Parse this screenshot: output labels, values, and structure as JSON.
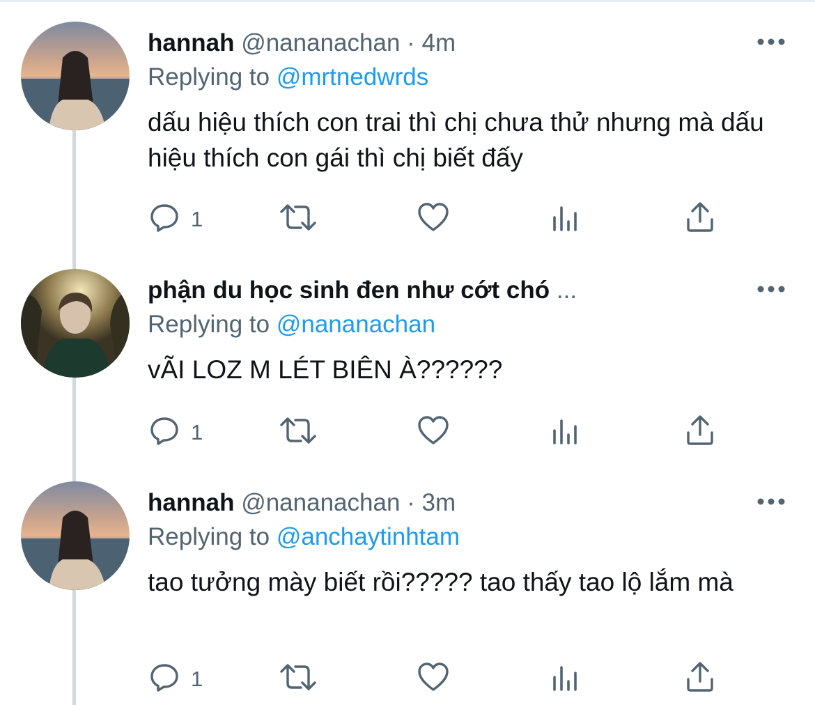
{
  "colors": {
    "link": "#1d9bf0",
    "secondary_text": "#536471",
    "primary_text": "#0f1419",
    "icon": "#536471",
    "thread_line": "#cfd9de"
  },
  "tweets": [
    {
      "name": "hannah",
      "handle": "@nananachan",
      "separator": "·",
      "time": "4m",
      "replying_label": "Replying to",
      "replying_to": "@mrtnedwrds",
      "text": "dấu hiệu thích con trai thì chị chưa thử nhưng mà dấu hiệu thích con gái thì chị biết đấy",
      "reply_count": "1",
      "avatar_icon": "avatar-sunset-girl"
    },
    {
      "name": "phận du học sinh đen như cớt chó",
      "name_truncation": "...",
      "handle": "",
      "separator": "",
      "time": "",
      "replying_label": "Replying to",
      "replying_to": "@nananachan",
      "text": "vÃI LOZ M LÉT BIÊN À??????",
      "reply_count": "1",
      "avatar_icon": "avatar-forest-boy"
    },
    {
      "name": "hannah",
      "handle": "@nananachan",
      "separator": "·",
      "time": "3m",
      "replying_label": "Replying to",
      "replying_to": "@anchaytinhtam",
      "text": "tao tưởng mày biết rồi????? tao thấy tao lộ lắm mà",
      "reply_count": "1",
      "avatar_icon": "avatar-sunset-girl"
    }
  ],
  "icons": [
    "reply-icon",
    "retweet-icon",
    "like-icon",
    "analytics-icon",
    "share-icon",
    "more-icon"
  ]
}
